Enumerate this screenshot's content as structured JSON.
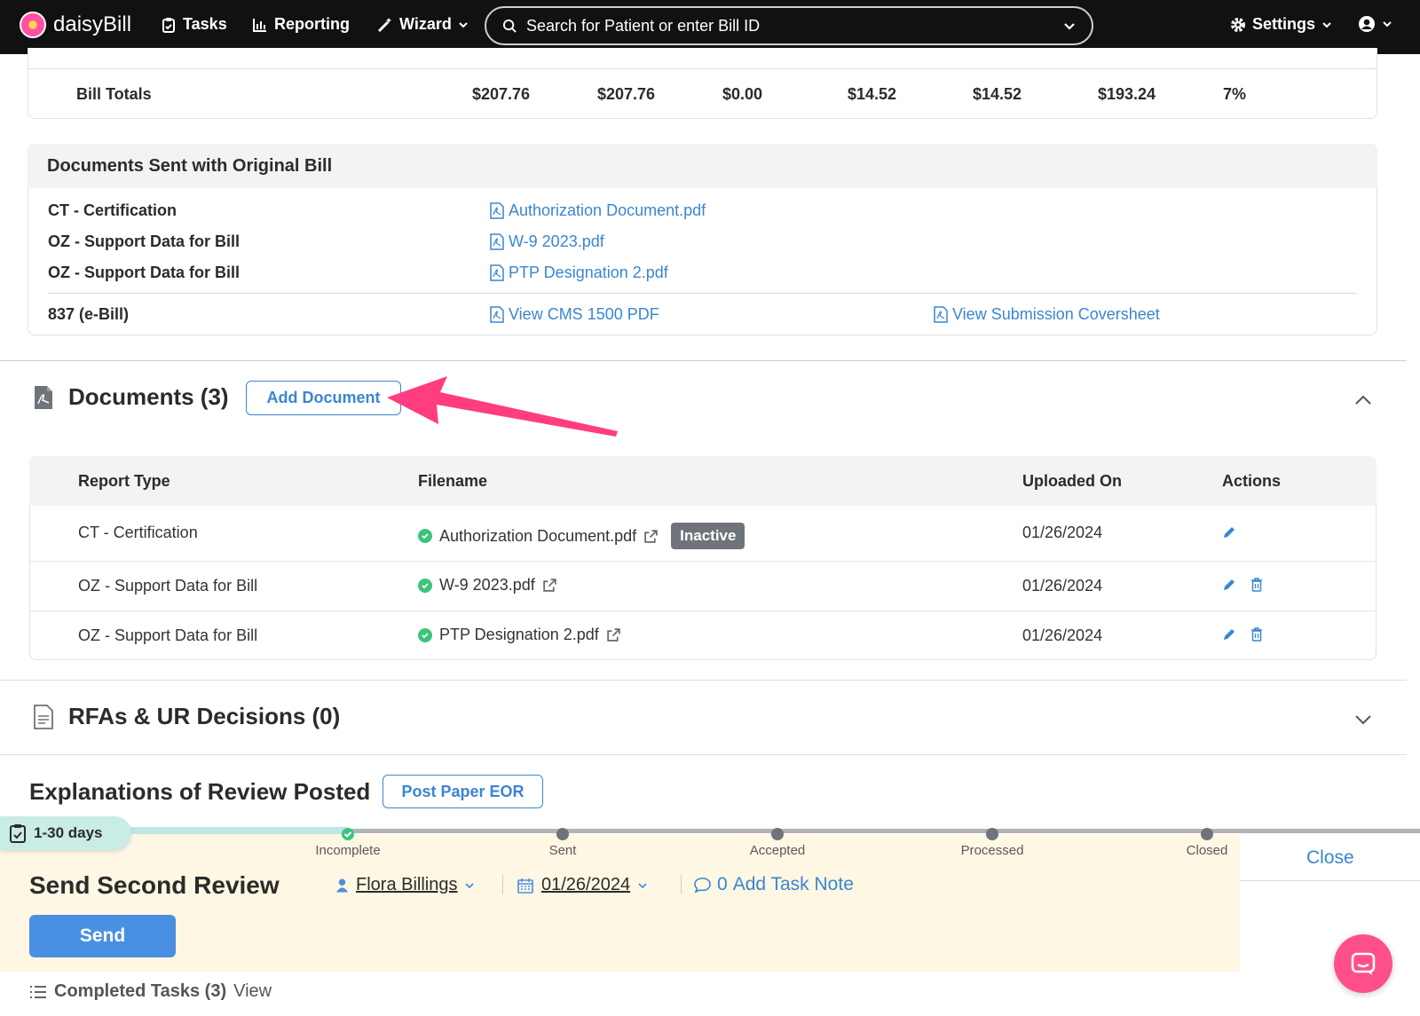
{
  "nav": {
    "logo": "daisyBill",
    "tasks": "Tasks",
    "reporting": "Reporting",
    "wizard": "Wizard",
    "search_placeholder": "Search for Patient or enter Bill ID",
    "settings": "Settings"
  },
  "bill_totals": {
    "label": "Bill Totals",
    "values": [
      "$207.76",
      "$207.76",
      "$0.00",
      "$14.52",
      "$14.52",
      "$193.24",
      "7%"
    ]
  },
  "docs_sent": {
    "title": "Documents Sent with Original Bill",
    "rows": [
      {
        "label": "CT - Certification",
        "link": "Authorization Document.pdf"
      },
      {
        "label": "OZ - Support Data for Bill",
        "link": "W-9 2023.pdf"
      },
      {
        "label": "OZ - Support Data for Bill",
        "link": "PTP Designation 2.pdf"
      }
    ],
    "ebill": {
      "label": "837 (e-Bill)",
      "cms_link": "View CMS 1500 PDF",
      "coversheet_link": "View Submission Coversheet"
    }
  },
  "documents": {
    "title": "Documents (3)",
    "add_button": "Add Document",
    "columns": [
      "Report Type",
      "Filename",
      "Uploaded On",
      "Actions"
    ],
    "rows": [
      {
        "type": "CT - Certification",
        "filename": "Authorization Document.pdf",
        "badge": "Inactive",
        "uploaded": "01/26/2024"
      },
      {
        "type": "OZ - Support Data for Bill",
        "filename": "W-9 2023.pdf",
        "uploaded": "01/26/2024"
      },
      {
        "type": "OZ - Support Data for Bill",
        "filename": "PTP Designation 2.pdf",
        "uploaded": "01/26/2024"
      }
    ]
  },
  "rfas": {
    "title": "RFAs & UR Decisions (0)"
  },
  "eor": {
    "title": "Explanations of Review Posted",
    "button": "Post Paper EOR"
  },
  "task": {
    "days": "1-30 days",
    "stages": [
      "Incomplete",
      "Sent",
      "Accepted",
      "Processed",
      "Closed"
    ],
    "title": "Send Second Review",
    "assignee": "Flora Billings",
    "date": "01/26/2024",
    "note_count": "0",
    "note_label": "Add Task Note",
    "send": "Send",
    "close": "Close",
    "completed_label": "Completed Tasks (3)",
    "completed_view": "View"
  },
  "colors": {
    "accent": "#3a86d1",
    "annotation_arrow": "#ff3d7f",
    "task_bg": "#fdf7e3",
    "chat": "#ff4f8b"
  }
}
